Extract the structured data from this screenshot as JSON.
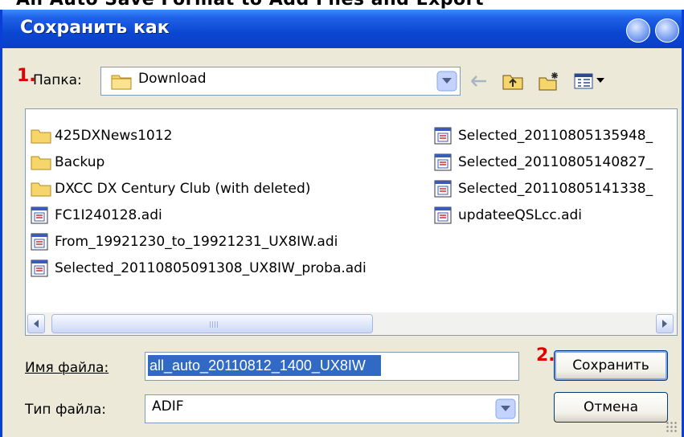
{
  "dialog": {
    "title": "Сохранить как",
    "top_strip_text": "All Auto Save Format to Add Files and Export"
  },
  "folder": {
    "number": "1.",
    "label": "Папка:",
    "value": "Download"
  },
  "files": [
    {
      "name": "425DXNews1012",
      "type": "folder"
    },
    {
      "name": "Backup",
      "type": "folder"
    },
    {
      "name": "DXCC DX Century Club (with deleted)",
      "type": "folder"
    },
    {
      "name": "FC1I240128.adi",
      "type": "file"
    },
    {
      "name": "From_19921230_to_19921231_UX8IW.adi",
      "type": "file"
    },
    {
      "name": "Selected_20110805091308_UX8IW_proba.adi",
      "type": "file"
    },
    {
      "name": "Selected_20110805135948_",
      "type": "file"
    },
    {
      "name": "Selected_20110805140827_",
      "type": "file"
    },
    {
      "name": "Selected_20110805141338_",
      "type": "file"
    },
    {
      "name": "updateeQSLcc.adi",
      "type": "file"
    }
  ],
  "filename": {
    "label": "Имя файла:",
    "value": "all_auto_20110812_1400_UX8IW"
  },
  "filetype": {
    "label": "Тип файла:",
    "value": "ADIF"
  },
  "buttons": {
    "save_number": "2.",
    "save": "Сохранить",
    "cancel": "Отмена"
  },
  "colors": {
    "titlebar": "#0b47d1",
    "annotation": "#e00000",
    "selection": "#316ac5"
  }
}
